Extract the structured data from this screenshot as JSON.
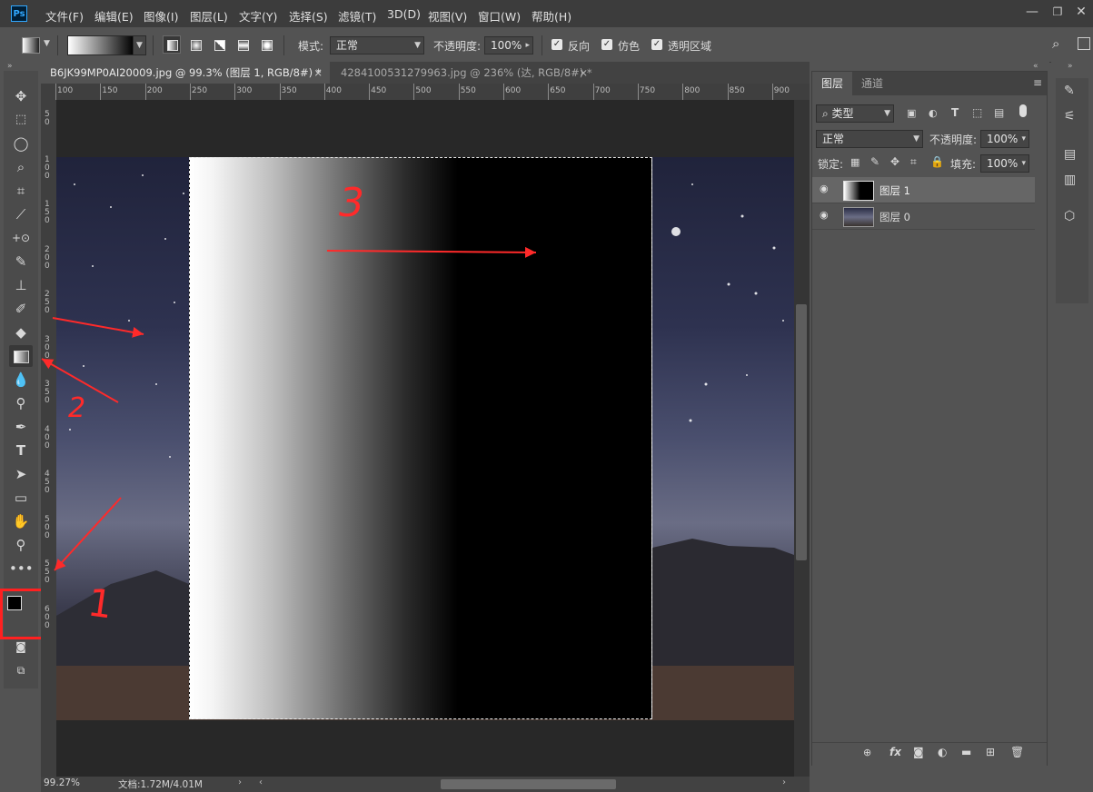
{
  "app": {
    "logo": "Ps"
  },
  "menu": [
    "文件(F)",
    "编辑(E)",
    "图像(I)",
    "图层(L)",
    "文字(Y)",
    "选择(S)",
    "滤镜(T)",
    "3D(D)",
    "视图(V)",
    "窗口(W)",
    "帮助(H)"
  ],
  "options": {
    "mode_label": "模式:",
    "mode_value": "正常",
    "opacity_label": "不透明度:",
    "opacity_value": "100%",
    "reverse_label": "反向",
    "dither_label": "仿色",
    "transparency_label": "透明区域"
  },
  "tabs": [
    {
      "label": "B6JK99MP0AI20009.jpg @ 99.3% (图层 1, RGB/8#) *",
      "active": true
    },
    {
      "label": "4284100531279963.jpg @ 236% (达, RGB/8#) *",
      "active": false
    }
  ],
  "ruler_top": [
    "100",
    "150",
    "200",
    "250",
    "300",
    "350",
    "400",
    "450",
    "500",
    "550",
    "600",
    "650",
    "700",
    "750",
    "800",
    "850",
    "900"
  ],
  "ruler_left": [
    "5 0",
    "1 0 0",
    "1 5 0",
    "2 0 0",
    "2 5 0",
    "3 0 0",
    "3 5 0",
    "4 0 0",
    "4 5 0",
    "5 0 0",
    "5 5 0",
    "6 0 0"
  ],
  "status": {
    "zoom": "99.27%",
    "doc": "文档:1.72M/4.01M"
  },
  "layers_panel": {
    "tabs": [
      "图层",
      "通道"
    ],
    "filter_label": "类型",
    "blend_mode": "正常",
    "opacity_label": "不透明度:",
    "opacity_value": "100%",
    "lock_label": "锁定:",
    "fill_label": "填充:",
    "fill_value": "100%",
    "layers": [
      {
        "name": "图层 1",
        "selected": true
      },
      {
        "name": "图层 0",
        "selected": false
      }
    ]
  },
  "annotations": [
    "1",
    "2",
    "3"
  ],
  "colors": {
    "annotation": "#ff2a2a",
    "foreground": "#000000",
    "background": "#ffffff"
  }
}
